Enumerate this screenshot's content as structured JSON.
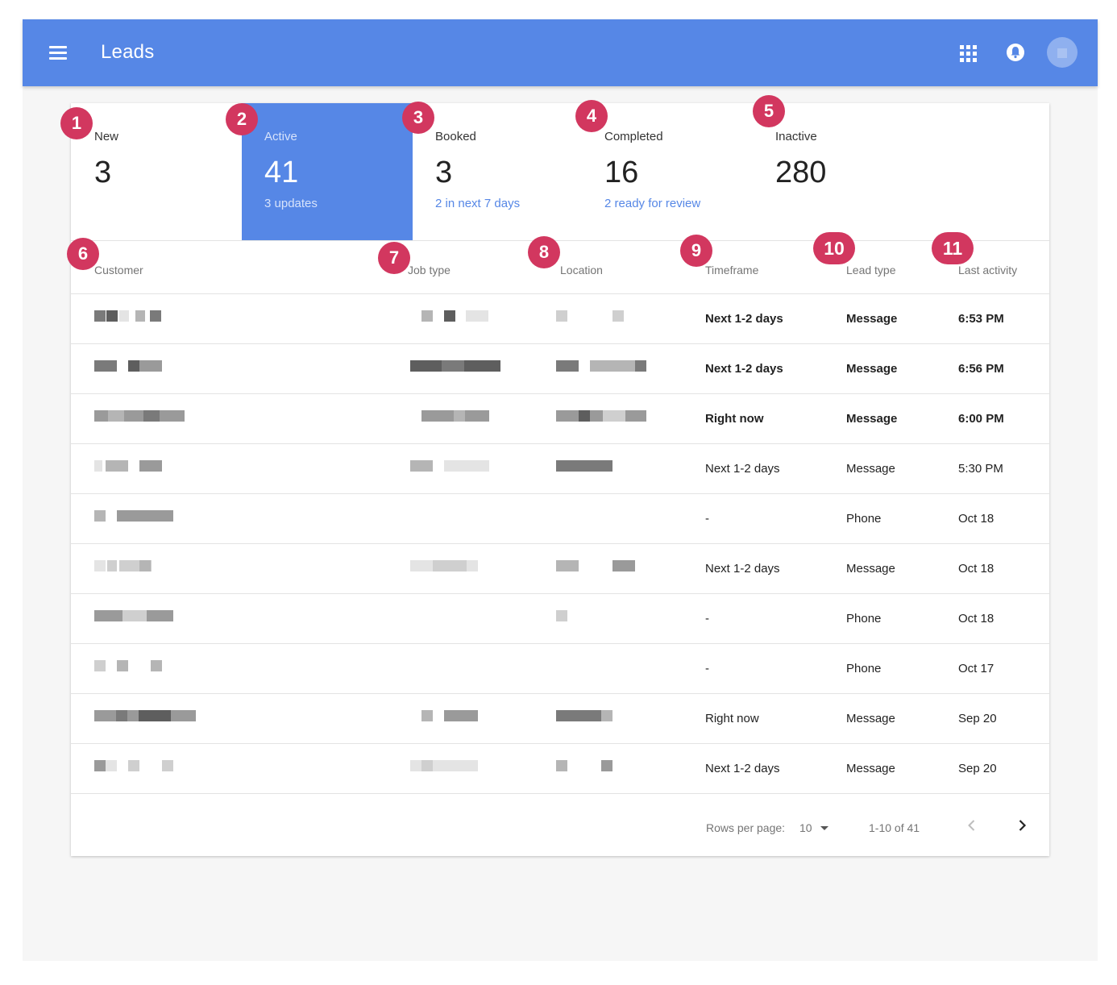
{
  "appbar": {
    "title": "Leads",
    "icons": [
      "menu-icon",
      "apps-icon",
      "notification-bell-icon",
      "avatar"
    ],
    "color": "#5687e6"
  },
  "stats": [
    {
      "label": "New",
      "count": "3",
      "sub": "",
      "active": false
    },
    {
      "label": "Active",
      "count": "41",
      "sub": "3 updates",
      "active": true
    },
    {
      "label": "Booked",
      "count": "3",
      "sub": "2 in next 7 days",
      "active": false
    },
    {
      "label": "Completed",
      "count": "16",
      "sub": "2 ready for review",
      "active": false
    },
    {
      "label": "Inactive",
      "count": "280",
      "sub": "",
      "active": false
    }
  ],
  "table": {
    "headers": [
      "Customer",
      "Job type",
      "Location",
      "Timeframe",
      "Lead type",
      "Last activity"
    ],
    "rows": [
      {
        "timeframe": "Next 1-2 days",
        "lead_type": "Message",
        "last_activity": "6:53 PM",
        "unread": true
      },
      {
        "timeframe": "Next 1-2 days",
        "lead_type": "Message",
        "last_activity": "6:56 PM",
        "unread": true
      },
      {
        "timeframe": "Right now",
        "lead_type": "Message",
        "last_activity": "6:00 PM",
        "unread": true
      },
      {
        "timeframe": "Next 1-2 days",
        "lead_type": "Message",
        "last_activity": "5:30 PM",
        "unread": false
      },
      {
        "timeframe": "-",
        "lead_type": "Phone",
        "last_activity": "Oct 18",
        "unread": false
      },
      {
        "timeframe": "Next 1-2 days",
        "lead_type": "Message",
        "last_activity": "Oct 18",
        "unread": false
      },
      {
        "timeframe": "-",
        "lead_type": "Phone",
        "last_activity": "Oct 18",
        "unread": false
      },
      {
        "timeframe": "-",
        "lead_type": "Phone",
        "last_activity": "Oct 17",
        "unread": false
      },
      {
        "timeframe": "Right now",
        "lead_type": "Message",
        "last_activity": "Sep 20",
        "unread": false
      },
      {
        "timeframe": "Next 1-2 days",
        "lead_type": "Message",
        "last_activity": "Sep 20",
        "unread": false
      }
    ]
  },
  "pagination": {
    "rows_per_page_label": "Rows per page:",
    "rows_per_page_value": "10",
    "range": "1-10 of 41",
    "prev_icon": "chevron-left-icon",
    "next_icon": "chevron-right-icon"
  },
  "callouts": [
    "1",
    "2",
    "3",
    "4",
    "5",
    "6",
    "7",
    "8",
    "9",
    "10",
    "11"
  ],
  "colors": {
    "accent": "#5687e6",
    "callout": "#d2375f"
  }
}
